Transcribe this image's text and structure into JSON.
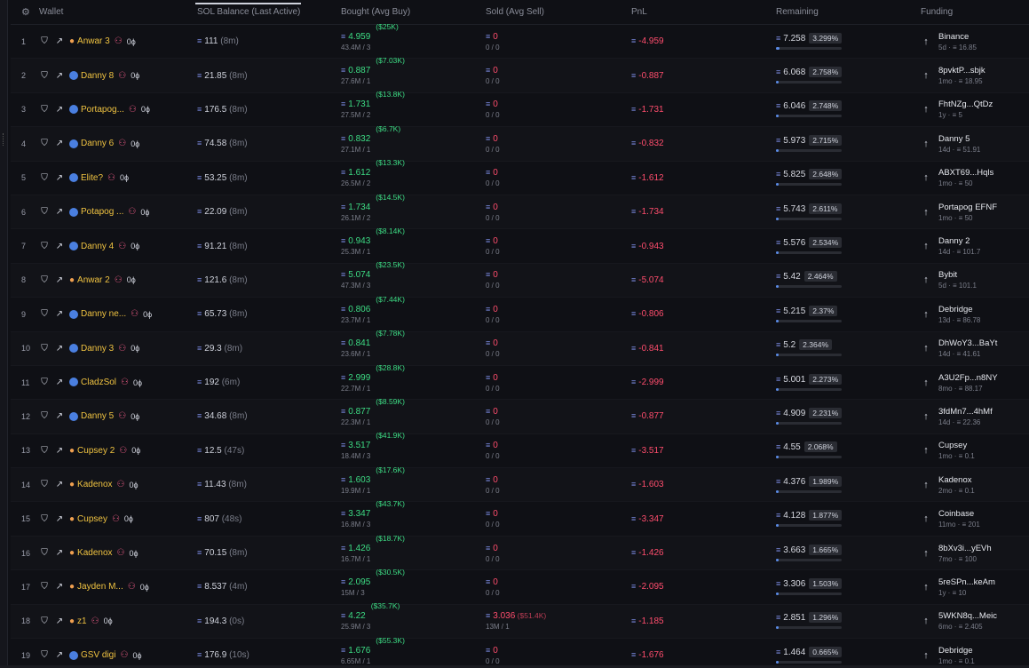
{
  "header": {
    "wallet": "Wallet",
    "sol": "SOL Balance (Last Active)",
    "bought": "Bought (Avg Buy)",
    "sold": "Sold (Avg Sell)",
    "pnl": "PnL",
    "remaining": "Remaining",
    "funding": "Funding"
  },
  "rows": [
    {
      "n": "1",
      "name": "Anwar 3",
      "avatar": "emoji",
      "sol": "111",
      "solt": "(8m)",
      "b": "4.959",
      "bs": "43.4M / 3",
      "bu": "($25K)",
      "s": "0",
      "ss": "0 / 0",
      "su": "",
      "pnl": "-4.959",
      "rem": "7.258",
      "pct": "3.299%",
      "fill": 0.033,
      "fn": "Binance",
      "fs": "5d · ≡ 16.85"
    },
    {
      "n": "2",
      "name": "Danny 8",
      "avatar": "dot",
      "sol": "21.85",
      "solt": "(8m)",
      "b": "0.887",
      "bs": "27.6M / 1",
      "bu": "($7.03K)",
      "s": "0",
      "ss": "0 / 0",
      "su": "",
      "pnl": "-0.887",
      "rem": "6.068",
      "pct": "2.758%",
      "fill": 0.028,
      "fn": "8pvktP...sbjk",
      "fs": "1mo · ≡ 18.95"
    },
    {
      "n": "3",
      "name": "Portapog...",
      "avatar": "dot",
      "sol": "176.5",
      "solt": "(8m)",
      "b": "1.731",
      "bs": "27.5M / 2",
      "bu": "($13.8K)",
      "s": "0",
      "ss": "0 / 0",
      "su": "",
      "pnl": "-1.731",
      "rem": "6.046",
      "pct": "2.748%",
      "fill": 0.027,
      "fn": "FhtNZg...QtDz",
      "fs": "1y · ≡ 5"
    },
    {
      "n": "4",
      "name": "Danny 6",
      "avatar": "dot",
      "sol": "74.58",
      "solt": "(8m)",
      "b": "0.832",
      "bs": "27.1M / 1",
      "bu": "($6.7K)",
      "s": "0",
      "ss": "0 / 0",
      "su": "",
      "pnl": "-0.832",
      "rem": "5.973",
      "pct": "2.715%",
      "fill": 0.027,
      "fn": "Danny 5",
      "fs": "14d · ≡ 51.91"
    },
    {
      "n": "5",
      "name": "Elite?",
      "avatar": "dot",
      "sol": "53.25",
      "solt": "(8m)",
      "b": "1.612",
      "bs": "26.5M / 2",
      "bu": "($13.3K)",
      "s": "0",
      "ss": "0 / 0",
      "su": "",
      "pnl": "-1.612",
      "rem": "5.825",
      "pct": "2.648%",
      "fill": 0.026,
      "fn": "ABXT69...Hqls",
      "fs": "1mo · ≡ 50"
    },
    {
      "n": "6",
      "name": "Potapog ...",
      "avatar": "dot",
      "sol": "22.09",
      "solt": "(8m)",
      "b": "1.734",
      "bs": "26.1M / 2",
      "bu": "($14.5K)",
      "s": "0",
      "ss": "0 / 0",
      "su": "",
      "pnl": "-1.734",
      "rem": "5.743",
      "pct": "2.611%",
      "fill": 0.026,
      "fn": "Portapog EFNF",
      "fs": "1mo · ≡ 50"
    },
    {
      "n": "7",
      "name": "Danny 4",
      "avatar": "dot",
      "sol": "91.21",
      "solt": "(8m)",
      "b": "0.943",
      "bs": "25.3M / 1",
      "bu": "($8.14K)",
      "s": "0",
      "ss": "0 / 0",
      "su": "",
      "pnl": "-0.943",
      "rem": "5.576",
      "pct": "2.534%",
      "fill": 0.025,
      "fn": "Danny 2",
      "fs": "14d · ≡ 101.7"
    },
    {
      "n": "8",
      "name": "Anwar 2",
      "avatar": "emoji",
      "sol": "121.6",
      "solt": "(8m)",
      "b": "5.074",
      "bs": "47.3M / 3",
      "bu": "($23.5K)",
      "s": "0",
      "ss": "0 / 0",
      "su": "",
      "pnl": "-5.074",
      "rem": "5.42",
      "pct": "2.464%",
      "fill": 0.025,
      "fn": "Bybit",
      "fs": "5d · ≡ 101.1"
    },
    {
      "n": "9",
      "name": "Danny ne...",
      "avatar": "dot",
      "sol": "65.73",
      "solt": "(8m)",
      "b": "0.806",
      "bs": "23.7M / 1",
      "bu": "($7.44K)",
      "s": "0",
      "ss": "0 / 0",
      "su": "",
      "pnl": "-0.806",
      "rem": "5.215",
      "pct": "2.37%",
      "fill": 0.024,
      "fn": "Debridge",
      "fs": "13d · ≡ 86.78"
    },
    {
      "n": "10",
      "name": "Danny 3",
      "avatar": "dot",
      "sol": "29.3",
      "solt": "(8m)",
      "b": "0.841",
      "bs": "23.6M / 1",
      "bu": "($7.78K)",
      "s": "0",
      "ss": "0 / 0",
      "su": "",
      "pnl": "-0.841",
      "rem": "5.2",
      "pct": "2.364%",
      "fill": 0.024,
      "fn": "DhWoY3...BaYt",
      "fs": "14d · ≡ 41.61"
    },
    {
      "n": "11",
      "name": "CladzSol",
      "avatar": "dot",
      "sol": "192",
      "solt": "(6m)",
      "b": "2.999",
      "bs": "22.7M / 1",
      "bu": "($28.8K)",
      "s": "0",
      "ss": "0 / 0",
      "su": "",
      "pnl": "-2.999",
      "rem": "5.001",
      "pct": "2.273%",
      "fill": 0.023,
      "fn": "A3U2Fp...n8NY",
      "fs": "8mo · ≡ 88.17"
    },
    {
      "n": "12",
      "name": "Danny 5",
      "avatar": "dot",
      "sol": "34.68",
      "solt": "(8m)",
      "b": "0.877",
      "bs": "22.3M / 1",
      "bu": "($8.59K)",
      "s": "0",
      "ss": "0 / 0",
      "su": "",
      "pnl": "-0.877",
      "rem": "4.909",
      "pct": "2.231%",
      "fill": 0.022,
      "fn": "3fdMn7...4hMf",
      "fs": "14d · ≡ 22.36"
    },
    {
      "n": "13",
      "name": "Cupsey 2",
      "avatar": "emoji",
      "sol": "12.5",
      "solt": "(47s)",
      "b": "3.517",
      "bs": "18.4M / 3",
      "bu": "($41.9K)",
      "s": "0",
      "ss": "0 / 0",
      "su": "",
      "pnl": "-3.517",
      "rem": "4.55",
      "pct": "2.068%",
      "fill": 0.021,
      "fn": "Cupsey",
      "fs": "1mo · ≡ 0.1"
    },
    {
      "n": "14",
      "name": "Kadenox",
      "avatar": "emoji",
      "sol": "11.43",
      "solt": "(8m)",
      "b": "1.603",
      "bs": "19.9M / 1",
      "bu": "($17.6K)",
      "s": "0",
      "ss": "0 / 0",
      "su": "",
      "pnl": "-1.603",
      "rem": "4.376",
      "pct": "1.989%",
      "fill": 0.02,
      "fn": "Kadenox",
      "fs": "2mo · ≡ 0.1"
    },
    {
      "n": "15",
      "name": "Cupsey",
      "avatar": "emoji",
      "sol": "807",
      "solt": "(48s)",
      "b": "3.347",
      "bs": "16.8M / 3",
      "bu": "($43.7K)",
      "s": "0",
      "ss": "0 / 0",
      "su": "",
      "pnl": "-3.347",
      "rem": "4.128",
      "pct": "1.877%",
      "fill": 0.019,
      "fn": "Coinbase",
      "fs": "11mo · ≡ 201"
    },
    {
      "n": "16",
      "name": "Kadenox",
      "avatar": "emoji",
      "sol": "70.15",
      "solt": "(8m)",
      "b": "1.426",
      "bs": "16.7M / 1",
      "bu": "($18.7K)",
      "s": "0",
      "ss": "0 / 0",
      "su": "",
      "pnl": "-1.426",
      "rem": "3.663",
      "pct": "1.665%",
      "fill": 0.017,
      "fn": "8bXv3i...yEVh",
      "fs": "7mo · ≡ 100"
    },
    {
      "n": "17",
      "name": "Jayden M...",
      "avatar": "emoji",
      "sol": "8.537",
      "solt": "(4m)",
      "b": "2.095",
      "bs": "15M / 3",
      "bu": "($30.5K)",
      "s": "0",
      "ss": "0 / 0",
      "su": "",
      "pnl": "-2.095",
      "rem": "3.306",
      "pct": "1.503%",
      "fill": 0.015,
      "fn": "5reSPn...keAm",
      "fs": "1y · ≡ 10"
    },
    {
      "n": "18",
      "name": "z1",
      "avatar": "emoji",
      "sol": "194.3",
      "solt": "(0s)",
      "b": "4.22",
      "bs": "25.9M / 3",
      "bu": "($35.7K)",
      "s": "3.036",
      "ss": "13M / 1",
      "su": "($51.4K)",
      "pnl": "-1.185",
      "rem": "2.851",
      "pct": "1.296%",
      "fill": 0.013,
      "fn": "5WKN8q...Meic",
      "fs": "6mo · ≡ 2.405"
    },
    {
      "n": "19",
      "name": "GSV digi",
      "avatar": "dot",
      "sol": "176.9",
      "solt": "(10s)",
      "b": "1.676",
      "bs": "6.65M / 1",
      "bu": "($55.3K)",
      "s": "0",
      "ss": "0 / 0",
      "su": "",
      "pnl": "-1.676",
      "rem": "1.464",
      "pct": "0.665%",
      "fill": 0.007,
      "fn": "Debridge",
      "fs": "1mo · ≡ 0.1"
    }
  ],
  "symbols": {
    "sol": "≡",
    "filter": "⛉",
    "link": "↗",
    "arrow": "↑",
    "gear": "⚙"
  }
}
